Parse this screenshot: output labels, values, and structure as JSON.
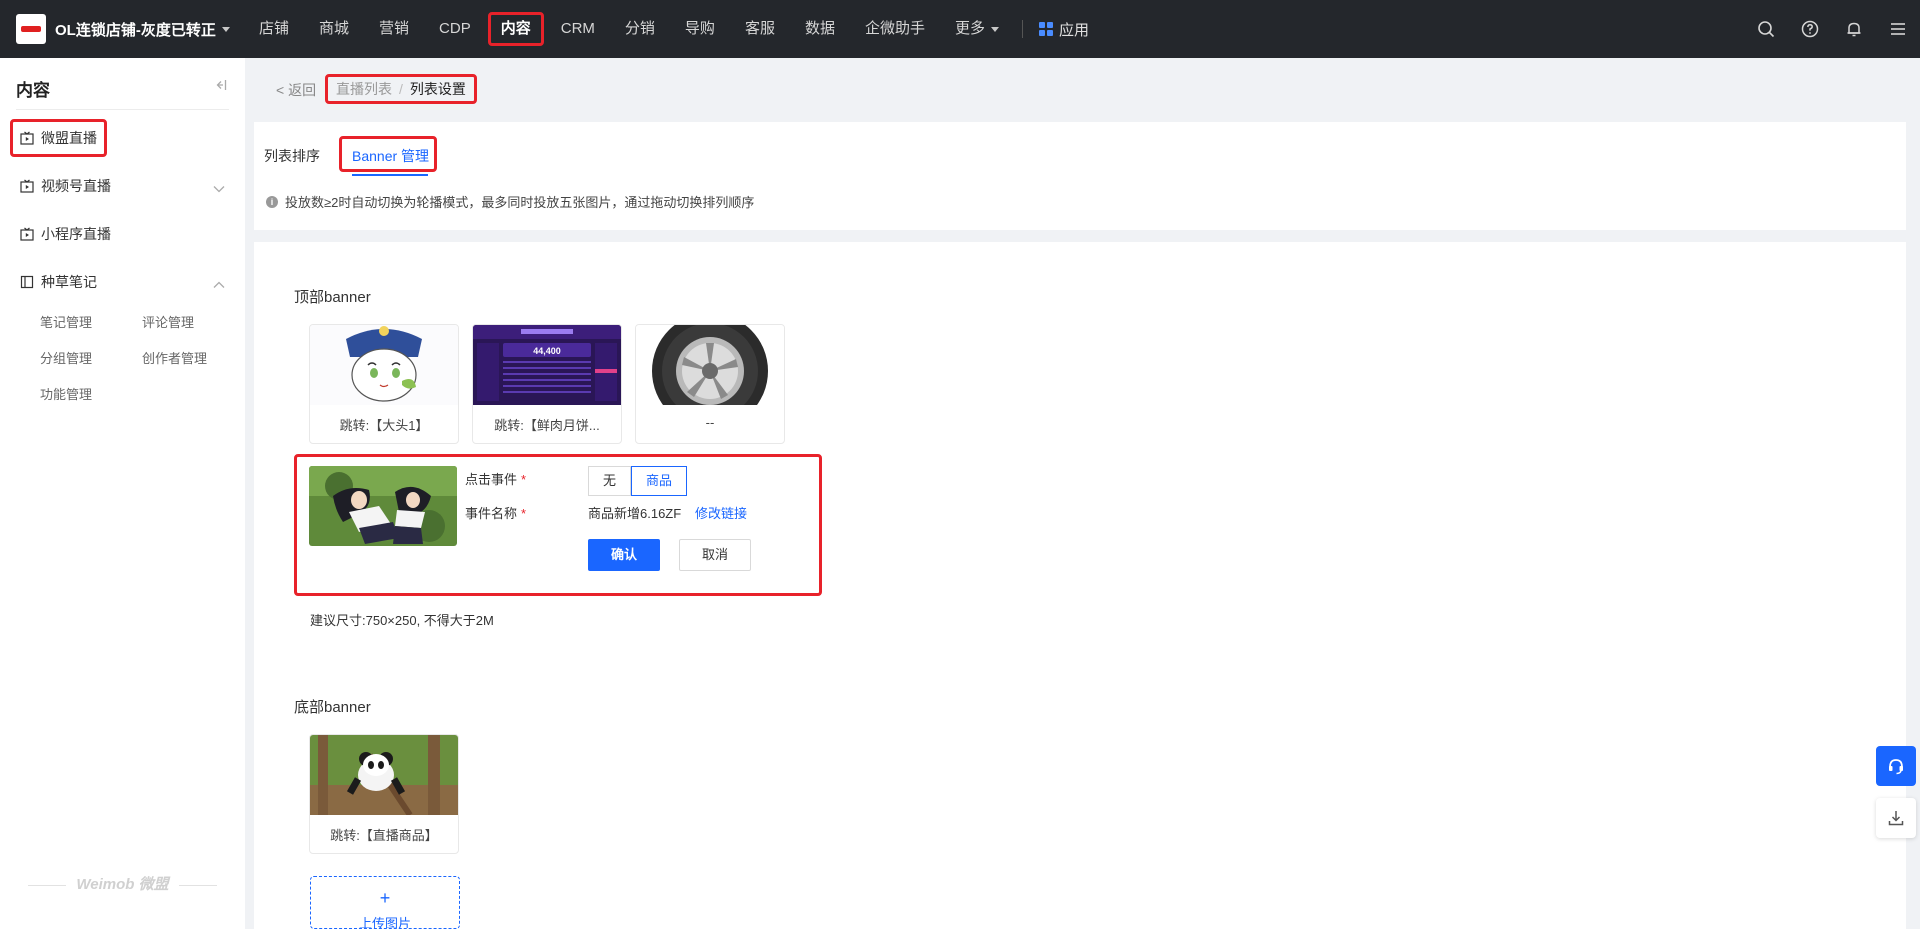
{
  "topbar": {
    "shop_name": "OL连锁店铺-灰度已转正",
    "nav": [
      "店铺",
      "商城",
      "营销",
      "CDP",
      "内容",
      "CRM",
      "分销",
      "导购",
      "客服",
      "数据",
      "企微助手"
    ],
    "more": "更多",
    "apps": "应用",
    "active_index": 4
  },
  "sidebar": {
    "title": "内容",
    "items": [
      {
        "label": "微盟直播"
      },
      {
        "label": "视频号直播"
      },
      {
        "label": "小程序直播"
      },
      {
        "label": "种草笔记"
      }
    ],
    "sub_items": [
      "笔记管理",
      "评论管理",
      "分组管理",
      "创作者管理",
      "功能管理"
    ],
    "brand": "Weimob 微盟"
  },
  "header": {
    "back": "< 返回",
    "crumb_link": "直播列表",
    "crumb_sep": "/",
    "crumb_current": "列表设置"
  },
  "tabs": {
    "tab1": "列表排序",
    "tab2": "Banner 管理",
    "tip": "投放数≥2时自动切换为轮播模式，最多同时投放五张图片，通过拖动切换排列顺序"
  },
  "top_banner": {
    "title": "顶部banner",
    "cards": [
      {
        "caption": "跳转:【大头1】"
      },
      {
        "caption": "跳转:【鲜肉月饼..."
      },
      {
        "caption": "--"
      }
    ],
    "screenshot_number": "44,400"
  },
  "edit": {
    "click_event_label": "点击事件",
    "event_name_label": "事件名称",
    "req": "*",
    "options": [
      "无",
      "商品"
    ],
    "selected": "商品",
    "event_name": "商品新增6.16ZF",
    "edit_link": "修改链接",
    "confirm": "确认",
    "cancel": "取消"
  },
  "size_tip": "建议尺寸:750×250, 不得大于2M",
  "bottom_banner": {
    "title": "底部banner",
    "cards": [
      {
        "caption": "跳转:【直播商品】"
      }
    ],
    "upload_plus": "+",
    "upload_label": "上传图片"
  },
  "colors": {
    "accent": "#1a66ff",
    "highlight": "#e8222a",
    "topbar": "#24272c"
  }
}
